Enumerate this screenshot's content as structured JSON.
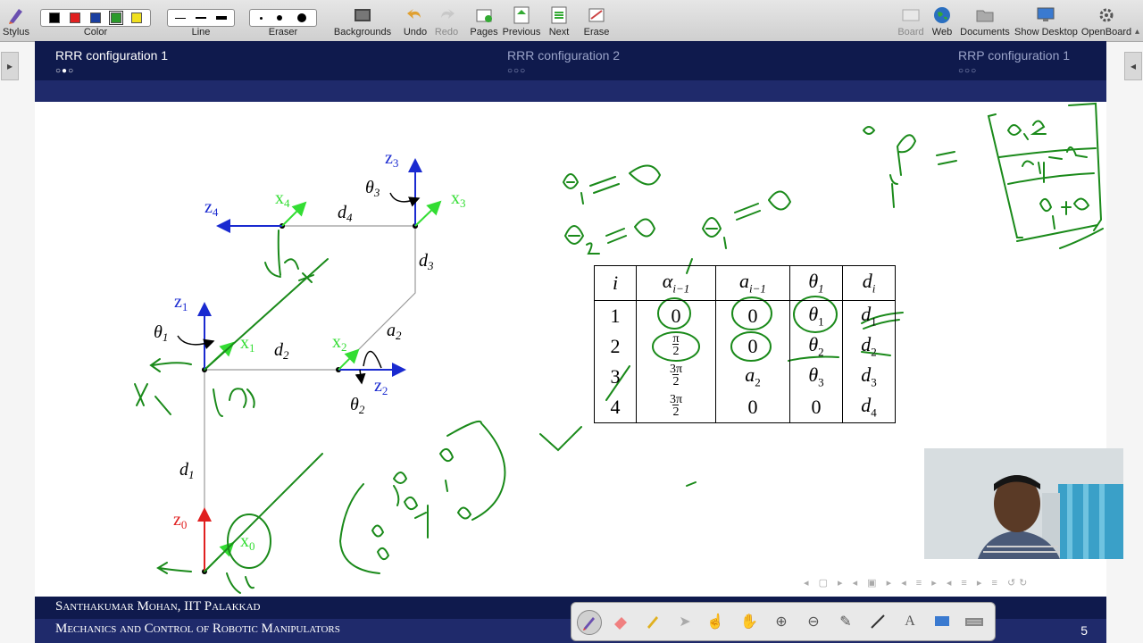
{
  "toolbar": {
    "items": [
      {
        "id": "stylus",
        "label": "Stylus"
      },
      {
        "id": "color",
        "label": "Color"
      },
      {
        "id": "line",
        "label": "Line"
      },
      {
        "id": "eraser",
        "label": "Eraser"
      },
      {
        "id": "backgrounds",
        "label": "Backgrounds"
      },
      {
        "id": "undo",
        "label": "Undo"
      },
      {
        "id": "redo",
        "label": "Redo"
      },
      {
        "id": "pages",
        "label": "Pages"
      },
      {
        "id": "previous",
        "label": "Previous"
      },
      {
        "id": "next",
        "label": "Next"
      },
      {
        "id": "erase",
        "label": "Erase"
      },
      {
        "id": "board",
        "label": "Board"
      },
      {
        "id": "web",
        "label": "Web"
      },
      {
        "id": "documents",
        "label": "Documents"
      },
      {
        "id": "show_desktop",
        "label": "Show Desktop"
      },
      {
        "id": "openboard",
        "label": "OpenBoard"
      }
    ],
    "colors": [
      "#000000",
      "#e02020",
      "#1a3fa0",
      "#2a9a2a",
      "#f0e020"
    ]
  },
  "slide": {
    "sections": [
      {
        "title": "RRR configuration 1",
        "dots": "○●○"
      },
      {
        "title": "RRR configuration 2",
        "dots": "○○○"
      },
      {
        "title": "RRP configuration 1",
        "dots": "○○○"
      }
    ],
    "footer_author": "Santhakumar Mohan, IIT Palakkad",
    "footer_title": "Mechanics and Control of Robotic Manipulators",
    "page_number": "5"
  },
  "table": {
    "headers": [
      "i",
      "α",
      "i−1",
      "a",
      "i−1",
      "θ",
      "1",
      "d",
      "i"
    ],
    "rows": [
      [
        "1",
        "0",
        "0",
        "θ",
        "1",
        "d",
        "1"
      ],
      [
        "2",
        "π",
        "2",
        "0",
        "θ",
        "2",
        "d",
        "2"
      ],
      [
        "3",
        "3π",
        "2",
        "a",
        "2",
        "θ",
        "3",
        "d",
        "3"
      ],
      [
        "4",
        "3π",
        "2",
        "0",
        "0",
        "d",
        "4"
      ]
    ]
  },
  "diagram": {
    "labels": [
      "z",
      "3",
      "x",
      "3",
      "θ",
      "3",
      "z",
      "4",
      "x",
      "4",
      "d",
      "4",
      "d",
      "3",
      "z",
      "1",
      "θ",
      "1",
      "x",
      "1",
      "d",
      "2",
      "x",
      "2",
      "a",
      "2",
      "z",
      "2",
      "θ",
      "2",
      "d",
      "1",
      "z",
      "0",
      "x",
      "0"
    ]
  }
}
